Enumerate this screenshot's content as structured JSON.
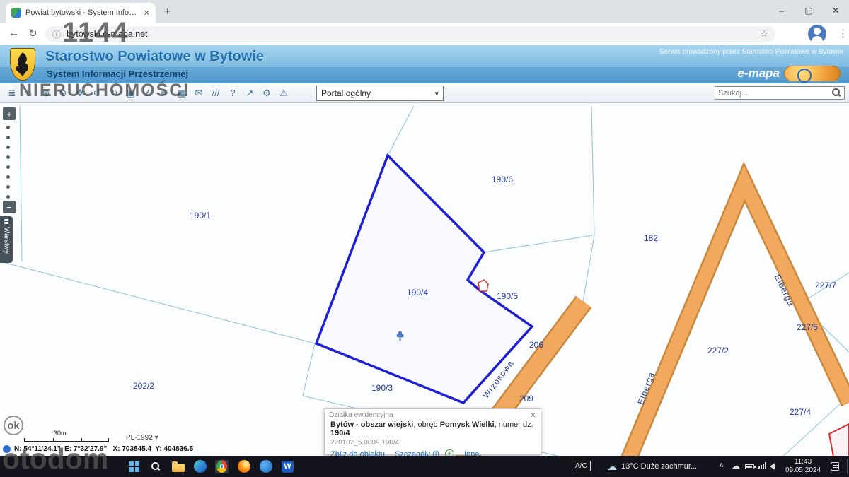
{
  "browser": {
    "tab_title": "Powiat bytowski - System Infor...",
    "url": "bytowski.e-mapa.net",
    "icons": {
      "back": "←",
      "refresh": "↻",
      "info": "ⓘ",
      "star": "☆",
      "menu": "⋮",
      "close_tab": "✕",
      "new_tab": "+",
      "minimize": "–",
      "maximize": "▢",
      "close": "✕"
    }
  },
  "header": {
    "title": "Starostwo Powiatowe w Bytowie",
    "subtitle": "System Informacji Przestrzennej",
    "service_note": "Serwis prowadzony przez Starostwo Powiatowe w Bytowie",
    "brand": "e-mapa"
  },
  "toolbar": {
    "portal_select": "Portal ogólny",
    "search_placeholder": "Szukaj...",
    "icons": [
      {
        "name": "layers-icon",
        "glyph": "≣"
      },
      {
        "name": "home-icon",
        "glyph": "⌂"
      },
      {
        "name": "zoom-in-icon",
        "glyph": "⊕"
      },
      {
        "name": "zoom-out-icon",
        "glyph": "⊖"
      },
      {
        "name": "pan-icon",
        "glyph": "✥"
      },
      {
        "name": "previous-view-icon",
        "glyph": "↺"
      },
      {
        "name": "next-view-icon",
        "glyph": "↻"
      },
      {
        "name": "full-extent-icon",
        "glyph": "▣"
      },
      {
        "name": "measure-icon",
        "glyph": "∠"
      },
      {
        "name": "draw-icon",
        "glyph": "✏"
      },
      {
        "name": "table-icon",
        "glyph": "▦"
      },
      {
        "name": "message-icon",
        "glyph": "✉"
      },
      {
        "name": "hatch-icon",
        "glyph": "///"
      },
      {
        "name": "help-icon",
        "glyph": "?"
      },
      {
        "name": "share-icon",
        "glyph": "↗"
      },
      {
        "name": "settings-icon",
        "glyph": "⚙"
      },
      {
        "name": "warning-icon",
        "glyph": "⚠"
      }
    ]
  },
  "map": {
    "zoom_in": "+",
    "zoom_out": "−",
    "layers_icon": "≣",
    "layers_tab": "Warstwy",
    "scale_label": "30m",
    "crs": "PL-1992",
    "coords": "N: 54°11'24.1\"  E: 7°32'27.9\"   X: 703845.4  Y: 404836.5",
    "parcels": [
      "190/1",
      "190/6",
      "190/4",
      "190/5",
      "190/3",
      "202/2",
      "182",
      "227/7",
      "227/5",
      "227/2",
      "227/4",
      "206",
      "209"
    ],
    "streets": [
      "Wrzosowa",
      "Elberga",
      "Elberga"
    ]
  },
  "popup": {
    "title": "Działka ewidencyjna",
    "close": "✕",
    "region": "Bytów - obszar wiejski",
    "obreb_label": ", obręb ",
    "obreb": "Pomysk Wielki",
    "numer_label": ", numer dz. ",
    "numer": "190/4",
    "id": "220102_5.0009 190/4",
    "link_zoom": "Zbliż do obiektu",
    "link_details": "Szczegóły (i)",
    "plus": "+",
    "link_other": "Inne"
  },
  "taskbar": {
    "word_glyph": "W",
    "ac": "A/C",
    "weather_cloud": "☁",
    "weather": "13°C  Duże zachmur...",
    "tray_expand": "∧",
    "tray_cloud": "☁",
    "time": "11:43",
    "date": "09.05.2024"
  },
  "watermarks": {
    "top": "1144",
    "mid": "NIERUCHOMOŚCI",
    "ok": "ok",
    "bottom": "otodom"
  }
}
